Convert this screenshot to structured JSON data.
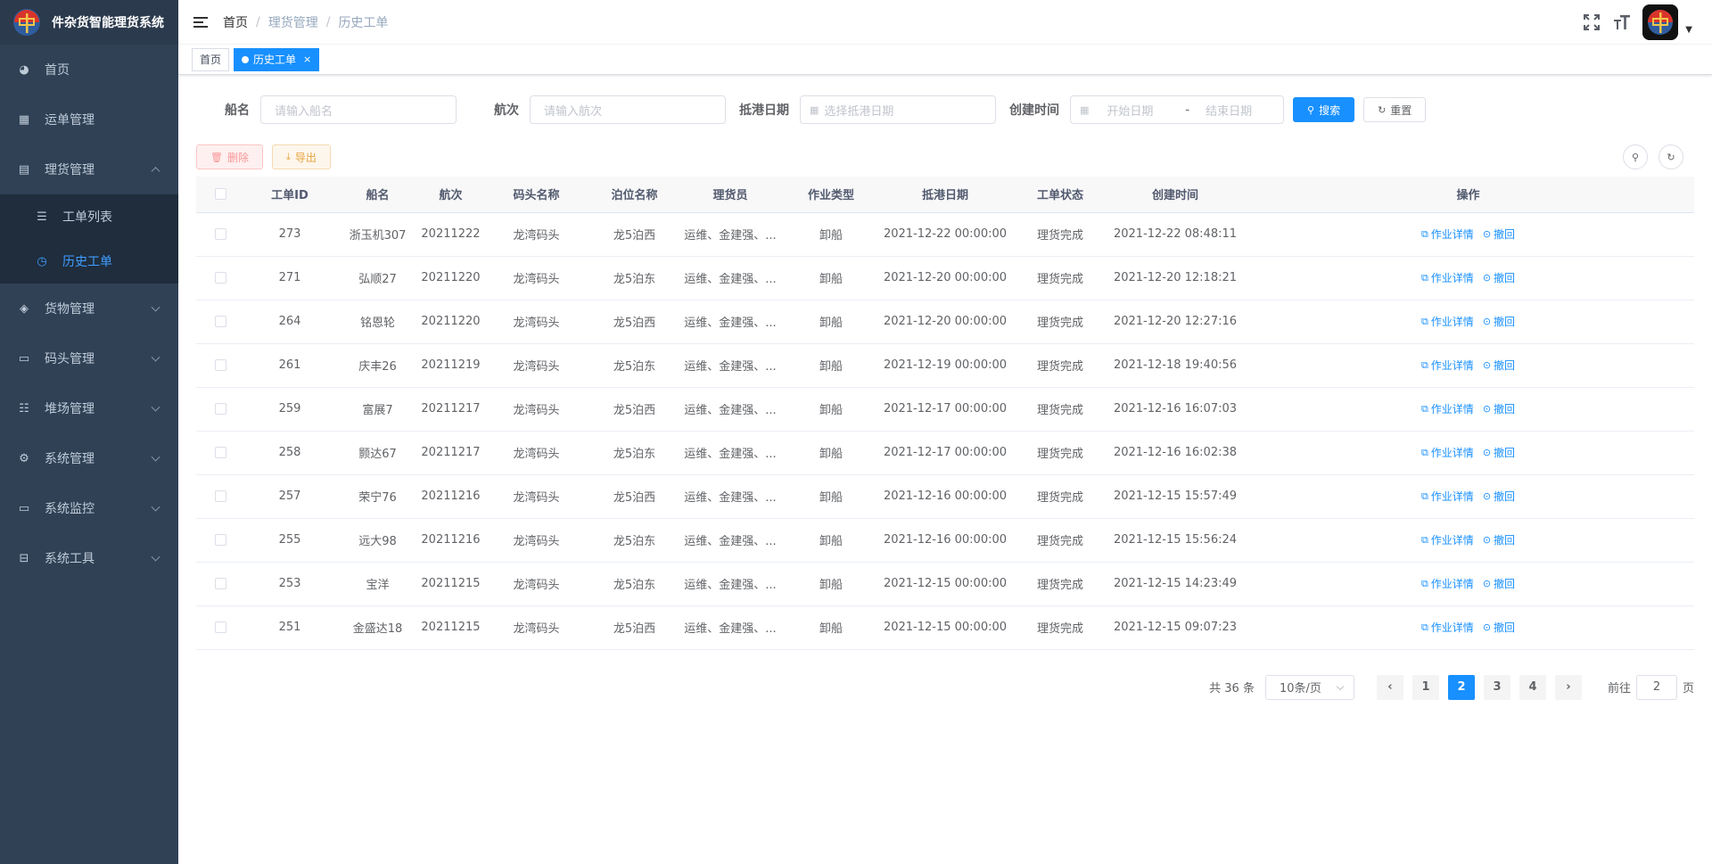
{
  "app": {
    "title": "件杂货智能理货系统"
  },
  "sidebar": {
    "items": [
      {
        "label": "首页",
        "icon": "dashboard-icon"
      },
      {
        "label": "运单管理",
        "icon": "table-icon"
      },
      {
        "label": "理货管理",
        "icon": "document-icon",
        "expanded": true,
        "children": [
          {
            "label": "工单列表",
            "icon": "list-icon",
            "active": false
          },
          {
            "label": "历史工单",
            "icon": "clock-icon",
            "active": true
          }
        ]
      },
      {
        "label": "货物管理",
        "icon": "box-icon"
      },
      {
        "label": "码头管理",
        "icon": "monitor-icon"
      },
      {
        "label": "堆场管理",
        "icon": "sliders-icon"
      },
      {
        "label": "系统管理",
        "icon": "gear-icon"
      },
      {
        "label": "系统监控",
        "icon": "monitor-icon"
      },
      {
        "label": "系统工具",
        "icon": "toolbox-icon"
      }
    ]
  },
  "breadcrumb": [
    "首页",
    "理货管理",
    "历史工单"
  ],
  "tags": [
    {
      "label": "首页",
      "active": false
    },
    {
      "label": "历史工单",
      "active": true,
      "close": "×"
    }
  ],
  "search": {
    "ship_label": "船名",
    "ship_placeholder": "请输入船名",
    "voyage_label": "航次",
    "voyage_placeholder": "请输入航次",
    "arrival_label": "抵港日期",
    "arrival_placeholder": "选择抵港日期",
    "created_label": "创建时间",
    "start_placeholder": "开始日期",
    "range_sep": "-",
    "end_placeholder": "结束日期",
    "search_btn": "搜索",
    "reset_btn": "重置"
  },
  "toolbar": {
    "delete_btn": "删除",
    "export_btn": "导出"
  },
  "table": {
    "headers": [
      "工单ID",
      "船名",
      "航次",
      "码头名称",
      "泊位名称",
      "理货员",
      "作业类型",
      "抵港日期",
      "工单状态",
      "创建时间",
      "操作"
    ],
    "op_detail": "作业详情",
    "op_revoke": "撤回",
    "rows": [
      {
        "id": "273",
        "ship": "浙玉机307",
        "voyage": "20211222",
        "wharf": "龙湾码头",
        "berth": "龙5泊西",
        "clerk": "运维、金建强、...",
        "type": "卸船",
        "arrival": "2021-12-22 00:00:00",
        "status": "理货完成",
        "created": "2021-12-22 08:48:11"
      },
      {
        "id": "271",
        "ship": "弘顺27",
        "voyage": "20211220",
        "wharf": "龙湾码头",
        "berth": "龙5泊东",
        "clerk": "运维、金建强、...",
        "type": "卸船",
        "arrival": "2021-12-20 00:00:00",
        "status": "理货完成",
        "created": "2021-12-20 12:18:21"
      },
      {
        "id": "264",
        "ship": "铭恩轮",
        "voyage": "20211220",
        "wharf": "龙湾码头",
        "berth": "龙5泊西",
        "clerk": "运维、金建强、...",
        "type": "卸船",
        "arrival": "2021-12-20 00:00:00",
        "status": "理货完成",
        "created": "2021-12-20 12:27:16"
      },
      {
        "id": "261",
        "ship": "庆丰26",
        "voyage": "20211219",
        "wharf": "龙湾码头",
        "berth": "龙5泊东",
        "clerk": "运维、金建强、...",
        "type": "卸船",
        "arrival": "2021-12-19 00:00:00",
        "status": "理货完成",
        "created": "2021-12-18 19:40:56"
      },
      {
        "id": "259",
        "ship": "富展7",
        "voyage": "20211217",
        "wharf": "龙湾码头",
        "berth": "龙5泊西",
        "clerk": "运维、金建强、...",
        "type": "卸船",
        "arrival": "2021-12-17 00:00:00",
        "status": "理货完成",
        "created": "2021-12-16 16:07:03"
      },
      {
        "id": "258",
        "ship": "颢达67",
        "voyage": "20211217",
        "wharf": "龙湾码头",
        "berth": "龙5泊东",
        "clerk": "运维、金建强、...",
        "type": "卸船",
        "arrival": "2021-12-17 00:00:00",
        "status": "理货完成",
        "created": "2021-12-16 16:02:38"
      },
      {
        "id": "257",
        "ship": "荣宁76",
        "voyage": "20211216",
        "wharf": "龙湾码头",
        "berth": "龙5泊西",
        "clerk": "运维、金建强、...",
        "type": "卸船",
        "arrival": "2021-12-16 00:00:00",
        "status": "理货完成",
        "created": "2021-12-15 15:57:49"
      },
      {
        "id": "255",
        "ship": "远大98",
        "voyage": "20211216",
        "wharf": "龙湾码头",
        "berth": "龙5泊东",
        "clerk": "运维、金建强、...",
        "type": "卸船",
        "arrival": "2021-12-16 00:00:00",
        "status": "理货完成",
        "created": "2021-12-15 15:56:24"
      },
      {
        "id": "253",
        "ship": "宝洋",
        "voyage": "20211215",
        "wharf": "龙湾码头",
        "berth": "龙5泊东",
        "clerk": "运维、金建强、...",
        "type": "卸船",
        "arrival": "2021-12-15 00:00:00",
        "status": "理货完成",
        "created": "2021-12-15 14:23:49"
      },
      {
        "id": "251",
        "ship": "金盛达18",
        "voyage": "20211215",
        "wharf": "龙湾码头",
        "berth": "龙5泊西",
        "clerk": "运维、金建强、...",
        "type": "卸船",
        "arrival": "2021-12-15 00:00:00",
        "status": "理货完成",
        "created": "2021-12-15 09:07:23"
      }
    ]
  },
  "pagination": {
    "total_text": "共 36 条",
    "page_size": "10条/页",
    "pages": [
      "1",
      "2",
      "3",
      "4"
    ],
    "current": "2",
    "prev": "‹",
    "next": "›",
    "goto_prefix": "前往",
    "goto_value": "2",
    "goto_suffix": "页"
  },
  "colors": {
    "sidebar_bg": "#304156",
    "primary": "#1890ff",
    "status_done": "#ff4949"
  }
}
